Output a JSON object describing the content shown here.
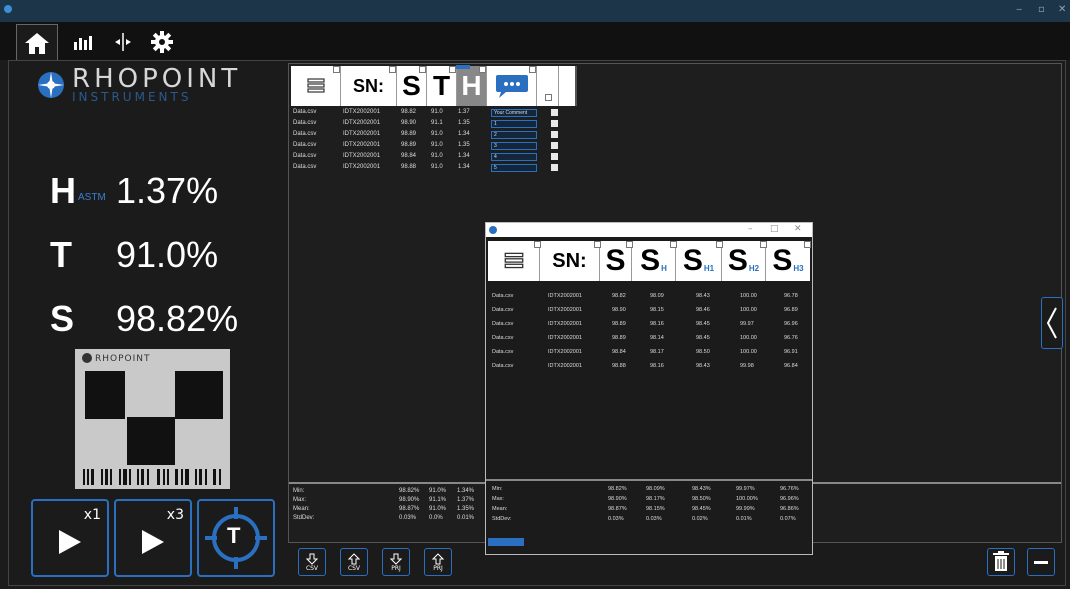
{
  "brand": {
    "name": "RHOPOINT",
    "sub": "INSTRUMENTS"
  },
  "readings": [
    {
      "label": "H",
      "sub": "ASTM",
      "value": "1.37%"
    },
    {
      "label": "T",
      "sub": "",
      "value": "91.0%"
    },
    {
      "label": "S",
      "sub": "",
      "value": "98.82%"
    }
  ],
  "buttons": {
    "measure_x1": "x1",
    "measure_x3": "x3",
    "target": "T"
  },
  "list": {
    "header": {
      "sn": "SN:",
      "s": "S",
      "t": "T",
      "h": "H"
    },
    "rows": [
      {
        "file": "Data.csv",
        "sn": "IDTX2002001",
        "s": "98.82",
        "t": "91.0",
        "h": "1.37",
        "comment": "Your Comment"
      },
      {
        "file": "Data.csv",
        "sn": "IDTX2002001",
        "s": "98.90",
        "t": "91.1",
        "h": "1.35",
        "comment": "1"
      },
      {
        "file": "Data.csv",
        "sn": "IDTX2002001",
        "s": "98.89",
        "t": "91.0",
        "h": "1.34",
        "comment": "2"
      },
      {
        "file": "Data.csv",
        "sn": "IDTX2002001",
        "s": "98.89",
        "t": "91.0",
        "h": "1.35",
        "comment": "3"
      },
      {
        "file": "Data.csv",
        "sn": "IDTX2002001",
        "s": "98.84",
        "t": "91.0",
        "h": "1.34",
        "comment": "4"
      },
      {
        "file": "Data.csv",
        "sn": "IDTX2002001",
        "s": "98.88",
        "t": "91.0",
        "h": "1.34",
        "comment": "5"
      }
    ],
    "stats": [
      {
        "label": "Min:",
        "s": "98.82%",
        "t": "91.0%",
        "h": "1.34%"
      },
      {
        "label": "Max:",
        "s": "98.90%",
        "t": "91.1%",
        "h": "1.37%"
      },
      {
        "label": "Mean:",
        "s": "98.87%",
        "t": "91.0%",
        "h": "1.35%"
      },
      {
        "label": "StdDev:",
        "s": "0.03%",
        "t": "0.0%",
        "h": "0.01%"
      }
    ]
  },
  "dialog": {
    "header": {
      "sn": "SN:",
      "s": "S",
      "sh": "H",
      "sh1": "H1",
      "sh2": "H2",
      "sh3": "H3"
    },
    "rows": [
      {
        "file": "Data.csv",
        "sn": "IDTX2002001",
        "s": "98.82",
        "sh": "98.09",
        "sh1": "98.43",
        "sh2": "100.00",
        "sh3": "96.78"
      },
      {
        "file": "Data.csv",
        "sn": "IDTX2002001",
        "s": "98.90",
        "sh": "98.15",
        "sh1": "98.46",
        "sh2": "100.00",
        "sh3": "96.89"
      },
      {
        "file": "Data.csv",
        "sn": "IDTX2002001",
        "s": "98.89",
        "sh": "98.16",
        "sh1": "98.45",
        "sh2": "99.97",
        "sh3": "96.96"
      },
      {
        "file": "Data.csv",
        "sn": "IDTX2002001",
        "s": "98.89",
        "sh": "98.14",
        "sh1": "98.45",
        "sh2": "100.00",
        "sh3": "96.76"
      },
      {
        "file": "Data.csv",
        "sn": "IDTX2002001",
        "s": "98.84",
        "sh": "98.17",
        "sh1": "98.50",
        "sh2": "100.00",
        "sh3": "96.91"
      },
      {
        "file": "Data.csv",
        "sn": "IDTX2002001",
        "s": "98.88",
        "sh": "98.16",
        "sh1": "98.43",
        "sh2": "99.98",
        "sh3": "96.84"
      }
    ],
    "stats": [
      {
        "label": "Min:",
        "s": "98.82%",
        "sh": "98.09%",
        "sh1": "98.43%",
        "sh2": "99.97%",
        "sh3": "96.76%"
      },
      {
        "label": "Max:",
        "s": "98.90%",
        "sh": "98.17%",
        "sh1": "98.50%",
        "sh2": "100.00%",
        "sh3": "96.96%"
      },
      {
        "label": "Mean:",
        "s": "98.87%",
        "sh": "98.15%",
        "sh1": "98.45%",
        "sh2": "99.99%",
        "sh3": "96.86%"
      },
      {
        "label": "StdDev:",
        "s": "0.03%",
        "sh": "0.03%",
        "sh1": "0.02%",
        "sh2": "0.01%",
        "sh3": "0.07%"
      }
    ]
  },
  "footer": {
    "b1": "CSV",
    "b2": "CSV",
    "b3": "PRJ",
    "b4": "PRJ"
  },
  "colors": {
    "accent": "#2a6fc0",
    "background": "#1b1b1b",
    "titlebar": "#1c3548"
  },
  "icons": [
    "home-icon",
    "bar-chart-icon",
    "split-icon",
    "gear-icon",
    "database-icon",
    "comment-icon",
    "trash-icon",
    "minus-icon",
    "chevron-left-icon",
    "play-icon",
    "target-icon"
  ]
}
